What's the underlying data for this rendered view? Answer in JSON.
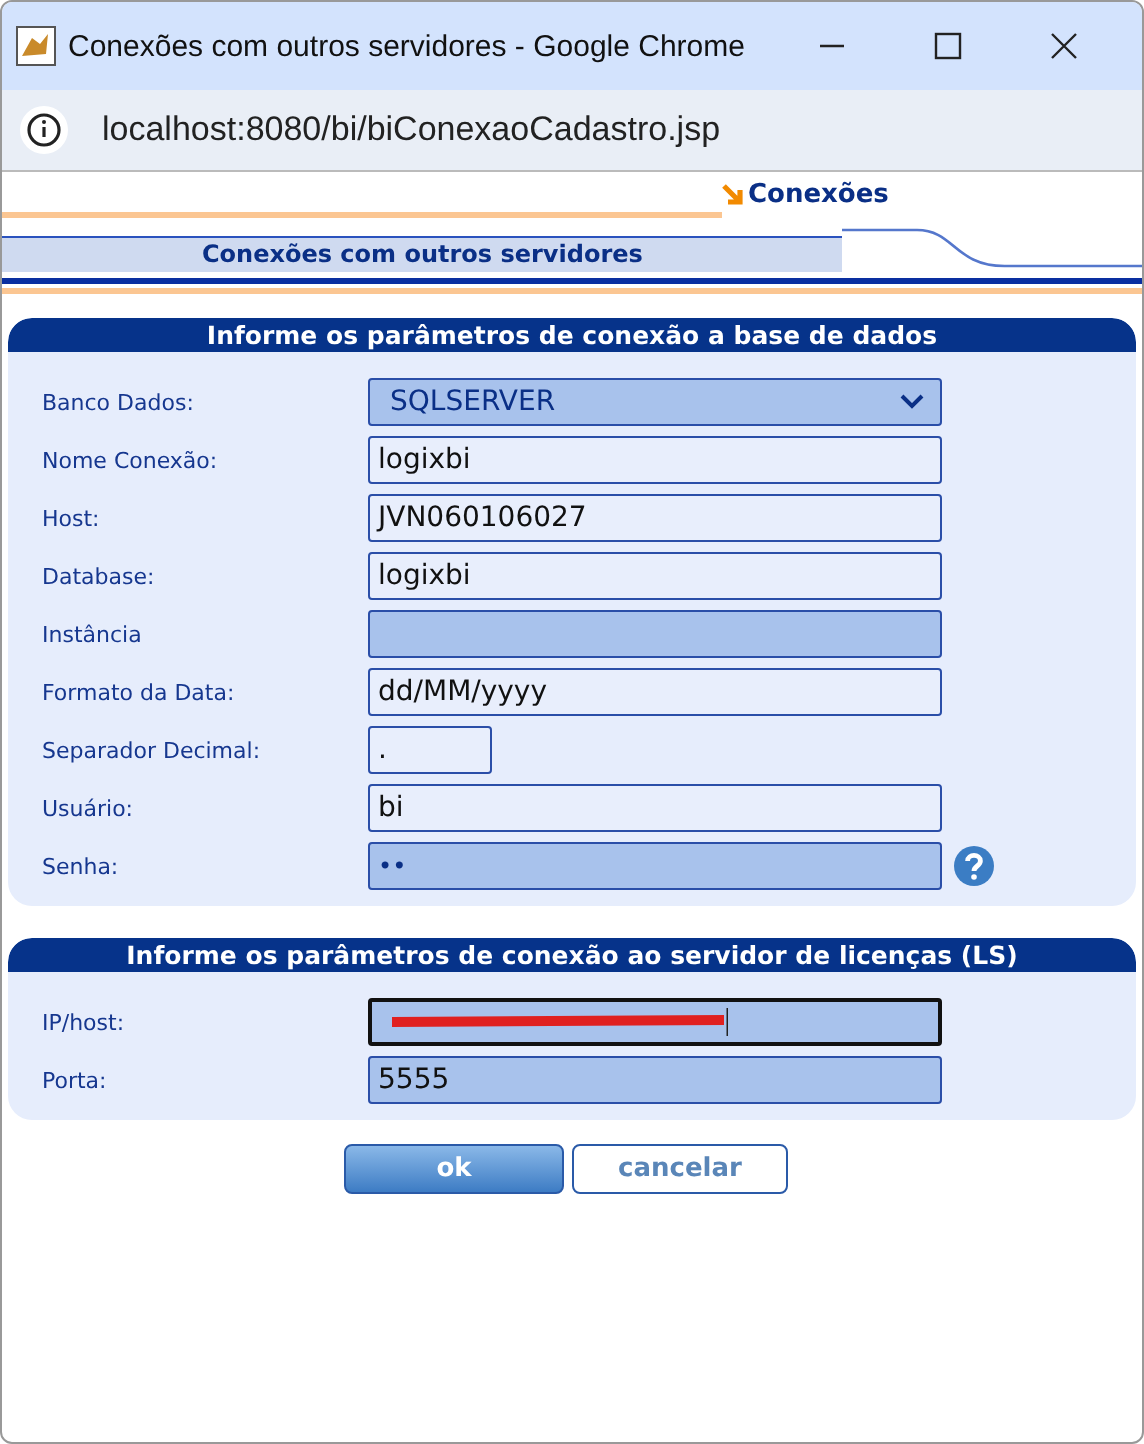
{
  "window": {
    "title": "Conexões com outros servidores - Google Chrome"
  },
  "address_bar": {
    "url": "localhost:8080/bi/biConexaoCadastro.jsp"
  },
  "breadcrumb": {
    "label": "Conexões"
  },
  "page_tab": {
    "label": "Conexões com outros servidores"
  },
  "sections": [
    {
      "title": "Informe os parâmetros de conexão a base de dados",
      "fields": [
        {
          "label": "Banco Dados:",
          "kind": "select",
          "value": "SQLSERVER",
          "shaded": true,
          "focused": false
        },
        {
          "label": "Nome Conexão:",
          "kind": "text",
          "value": "logixbi",
          "shaded": false,
          "focused": false
        },
        {
          "label": "Host:",
          "kind": "text",
          "value": "JVN060106027",
          "shaded": false,
          "focused": false
        },
        {
          "label": "Database:",
          "kind": "text",
          "value": "logixbi",
          "shaded": false,
          "focused": false
        },
        {
          "label": "Instância",
          "kind": "text",
          "shaded": true,
          "focused": false
        },
        {
          "label": "Formato da Data:",
          "kind": "text",
          "value": "dd/MM/yyyy",
          "shaded": false,
          "focused": false
        },
        {
          "label": "Separador Decimal:",
          "kind": "short",
          "value": ".",
          "shaded": false,
          "focused": false
        },
        {
          "label": "Usuário:",
          "kind": "text",
          "value": "bi",
          "shaded": false,
          "focused": false
        },
        {
          "label": "Senha:",
          "kind": "password",
          "value": "••",
          "shaded": true,
          "focused": false,
          "help": true
        }
      ]
    },
    {
      "title": "Informe os parâmetros de conexão ao servidor de licenças (LS)",
      "fields": [
        {
          "label": "IP/host:",
          "kind": "redacted",
          "shaded": true,
          "focused": true
        },
        {
          "label": "Porta:",
          "kind": "text",
          "value": "5555",
          "shaded": true,
          "focused": false
        }
      ]
    }
  ],
  "buttons": [
    {
      "label": "ok",
      "primary": true
    },
    {
      "label": "cancelar",
      "primary": false
    }
  ]
}
